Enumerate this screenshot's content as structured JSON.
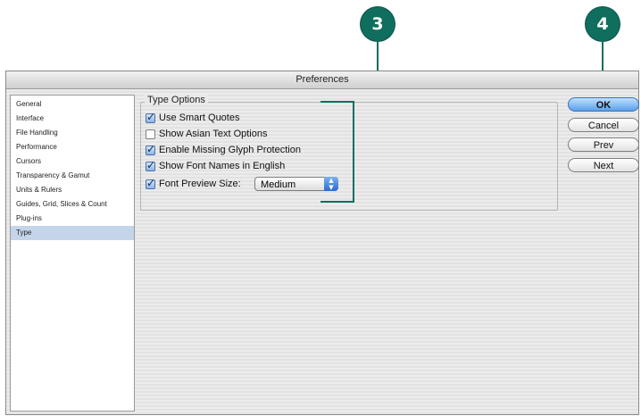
{
  "callouts": {
    "step3": "3",
    "step4": "4"
  },
  "window": {
    "title": "Preferences"
  },
  "sidebar": {
    "items": [
      {
        "label": "General"
      },
      {
        "label": "Interface"
      },
      {
        "label": "File Handling"
      },
      {
        "label": "Performance"
      },
      {
        "label": "Cursors"
      },
      {
        "label": "Transparency & Gamut"
      },
      {
        "label": "Units & Rulers"
      },
      {
        "label": "Guides, Grid, Slices & Count"
      },
      {
        "label": "Plug-ins"
      },
      {
        "label": "Type"
      }
    ],
    "selected": "Type"
  },
  "type_options": {
    "legend": "Type Options",
    "use_smart_quotes": {
      "label": "Use Smart Quotes",
      "checked": true
    },
    "show_asian_text": {
      "label": "Show Asian Text Options",
      "checked": false
    },
    "missing_glyph": {
      "label": "Enable Missing Glyph Protection",
      "checked": true
    },
    "font_names_english": {
      "label": "Show Font Names in English",
      "checked": true
    },
    "font_preview": {
      "label": "Font Preview Size:",
      "checked": true,
      "value": "Medium"
    }
  },
  "buttons": {
    "ok": "OK",
    "cancel": "Cancel",
    "prev": "Prev",
    "next": "Next"
  },
  "colors": {
    "accent": "#0f6e5e",
    "selection": "#c4d5ea",
    "default_button": "#5aa0ea"
  }
}
